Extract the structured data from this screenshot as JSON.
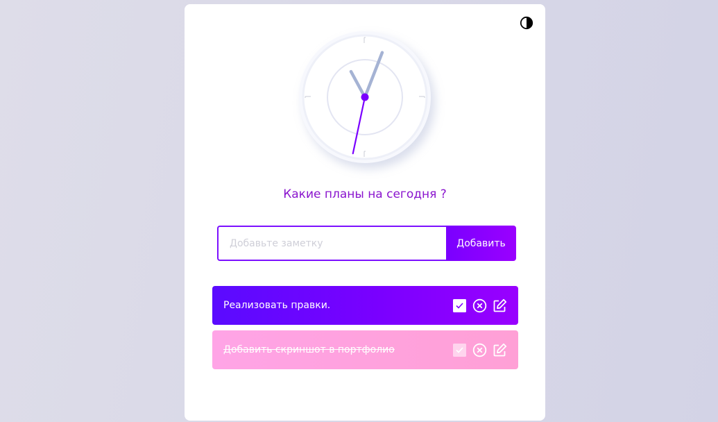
{
  "heading": "Какие планы на сегодня ?",
  "input": {
    "placeholder": "Добавьте заметку",
    "value": ""
  },
  "add_button_label": "Добавить",
  "todos": [
    {
      "text": "Реализовать правки.",
      "done": false
    },
    {
      "text": "Добавить скриншот в портфолио",
      "done": true
    }
  ],
  "clock": {
    "hour": 11,
    "minute": 3,
    "second": 32
  },
  "icons": {
    "theme_toggle": "half-circle-contrast-icon",
    "complete": "checkbox-check-icon",
    "delete": "circle-x-icon",
    "edit": "edit-pencil-icon"
  },
  "colors": {
    "accent": "#7c10ff",
    "heading": "#8a14ce",
    "todo_active": "#7a00ff",
    "todo_done": "#ffa4e6",
    "clock_hands": "#a5b3d4",
    "second_hand": "#7a00ff"
  }
}
